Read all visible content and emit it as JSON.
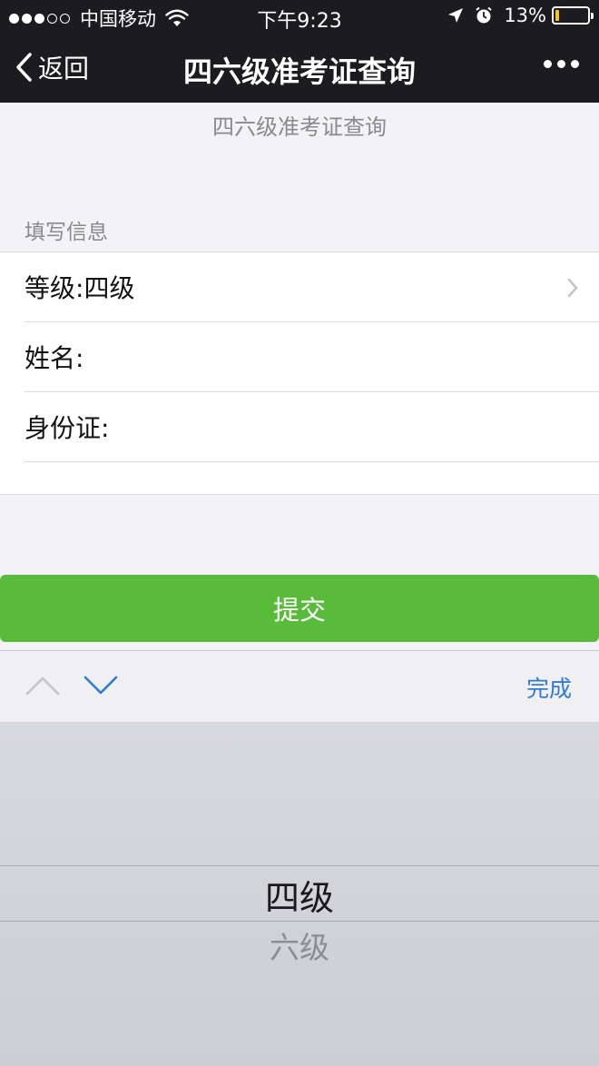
{
  "status_bar": {
    "carrier": "中国移动",
    "time": "下午9:23",
    "battery_percent": "13%",
    "battery_level": 0.13
  },
  "nav": {
    "back_label": "返回",
    "title": "四六级准考证查询"
  },
  "page": {
    "heading": "四六级准考证查询",
    "section_label": "填写信息"
  },
  "form": {
    "level_label": "等级:",
    "level_value": "四级",
    "name_label": "姓名:",
    "name_value": "",
    "id_label": "身份证:",
    "id_value": ""
  },
  "submit_label": "提交",
  "accessory": {
    "done_label": "完成"
  },
  "picker": {
    "options": [
      "四级",
      "六级"
    ],
    "selected": "四级"
  },
  "colors": {
    "accent_green": "#58bc3a",
    "link_blue": "#2f7bd8",
    "nav_dark": "#1c1c20"
  }
}
